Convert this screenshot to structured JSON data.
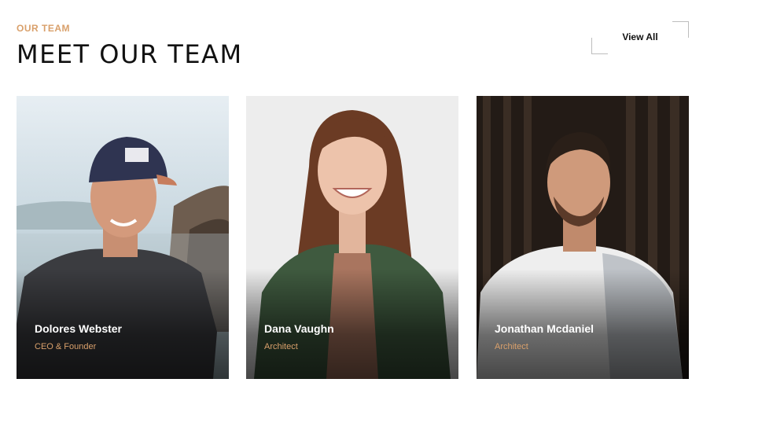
{
  "header": {
    "eyebrow": "OUR TEAM",
    "title": "MEET OUR TEAM",
    "view_all_label": "View All"
  },
  "colors": {
    "accent": "#d9a06b",
    "title": "#111111"
  },
  "team": [
    {
      "name": "Dolores Webster",
      "role": "CEO & Founder"
    },
    {
      "name": "Dana Vaughn",
      "role": "Architect"
    },
    {
      "name": "Jonathan Mcdaniel",
      "role": "Architect"
    }
  ]
}
